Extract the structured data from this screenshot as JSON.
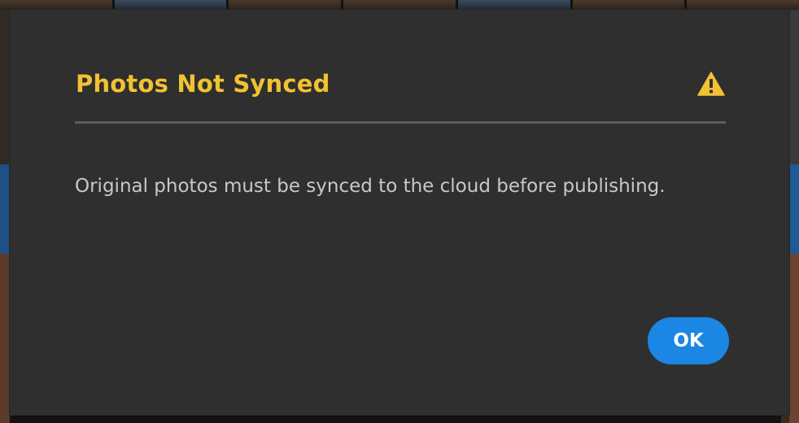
{
  "dialog": {
    "title": "Photos Not Synced",
    "icon": "warning-triangle",
    "message": "Original photos must be synced to the cloud before publishing.",
    "ok_label": "OK"
  },
  "colors": {
    "dialog_bg": "#2f2f2f",
    "title": "#f1c232",
    "message": "#c8c8c8",
    "accent_button": "#1b86e3",
    "divider": "#5e5e5e"
  }
}
